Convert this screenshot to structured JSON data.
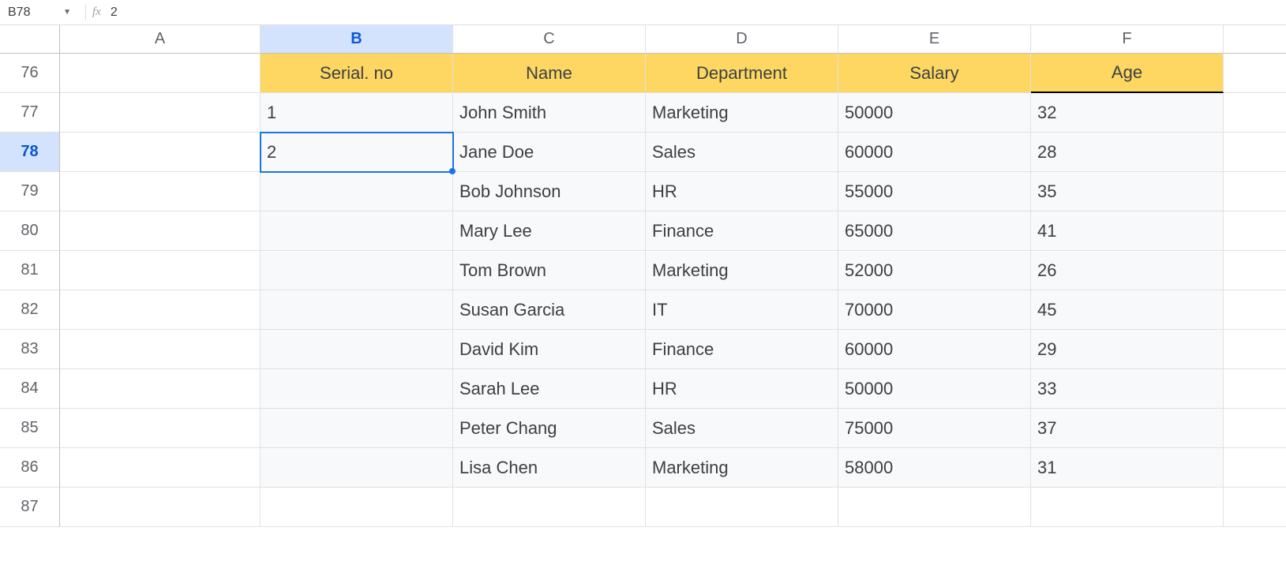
{
  "formula_bar": {
    "cell_ref": "B78",
    "fx_label": "fx",
    "value": "2"
  },
  "columns": [
    "A",
    "B",
    "C",
    "D",
    "E",
    "F"
  ],
  "active_column": "B",
  "rows": [
    "76",
    "77",
    "78",
    "79",
    "80",
    "81",
    "82",
    "83",
    "84",
    "85",
    "86",
    "87"
  ],
  "active_row": "78",
  "active_cell": {
    "row": "78",
    "col": "B"
  },
  "headers": {
    "B": "Serial. no",
    "C": "Name",
    "D": "Department",
    "E": "Salary",
    "F": "Age"
  },
  "data": [
    {
      "row": "77",
      "B": "1",
      "C": "John Smith",
      "D": "Marketing",
      "E": "50000",
      "F": "32"
    },
    {
      "row": "78",
      "B": "2",
      "C": "Jane Doe",
      "D": "Sales",
      "E": "60000",
      "F": "28"
    },
    {
      "row": "79",
      "B": "",
      "C": "Bob Johnson",
      "D": "HR",
      "E": "55000",
      "F": "35"
    },
    {
      "row": "80",
      "B": "",
      "C": "Mary Lee",
      "D": "Finance",
      "E": "65000",
      "F": "41"
    },
    {
      "row": "81",
      "B": "",
      "C": "Tom Brown",
      "D": "Marketing",
      "E": "52000",
      "F": "26"
    },
    {
      "row": "82",
      "B": "",
      "C": "Susan Garcia",
      "D": "IT",
      "E": "70000",
      "F": "45"
    },
    {
      "row": "83",
      "B": "",
      "C": "David Kim",
      "D": "Finance",
      "E": "60000",
      "F": "29"
    },
    {
      "row": "84",
      "B": "",
      "C": "Sarah Lee",
      "D": "HR",
      "E": "50000",
      "F": "33"
    },
    {
      "row": "85",
      "B": "",
      "C": "Peter Chang",
      "D": "Sales",
      "E": "75000",
      "F": "37"
    },
    {
      "row": "86",
      "B": "",
      "C": "Lisa Chen",
      "D": "Marketing",
      "E": "58000",
      "F": "31"
    }
  ]
}
